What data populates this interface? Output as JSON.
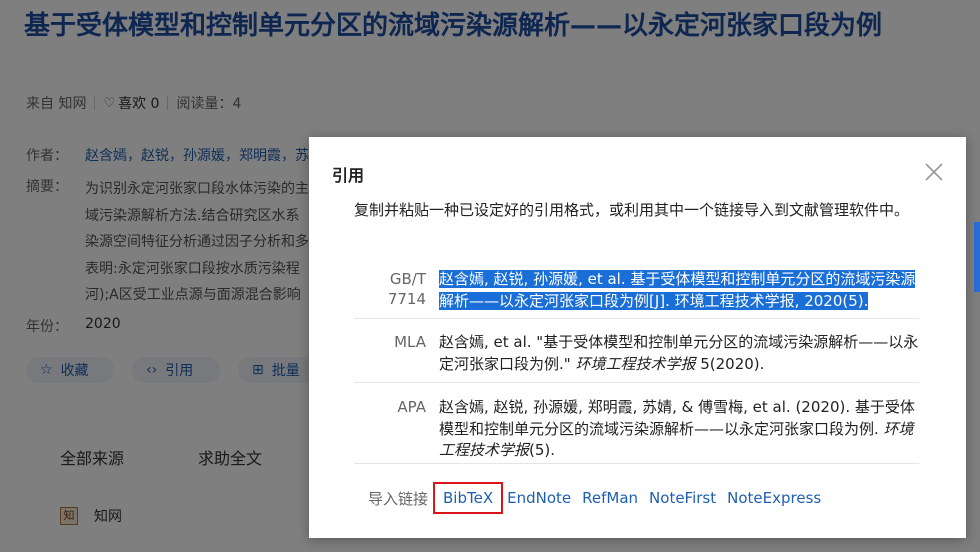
{
  "article": {
    "title": "基于受体模型和控制单元分区的流域污染源解析——以永定河张家口段为例",
    "source": "来自 知网",
    "like_label": "喜欢 0",
    "reads_label": "阅读量：4",
    "authors_label": "作者：",
    "authors": "赵含嫣，赵锐，孙源媛，郑明霞，苏",
    "abstract_label": "摘要：",
    "abstract_lines": [
      "为识别永定河张家口段水体污染的主",
      "域污染源解析方法.结合研究区水系",
      "染源空间特征分析通过因子分析和多",
      "表明:永定河张家口段按水质污染程",
      "河);A区受工业点源与面源混合影响"
    ],
    "year_label": "年份：",
    "year": "2020",
    "actions": {
      "favorite": "收藏",
      "cite": "引用",
      "batch": "批量"
    },
    "source_tabs": [
      "全部来源",
      "求助全文"
    ],
    "source_item": "知网",
    "source_logo": "知"
  },
  "modal": {
    "title": "引用",
    "instruction": "复制并粘贴一种已设定好的引用格式，或利用其中一个链接导入到文献管理软件中。",
    "citations": {
      "gbt": {
        "label": "GB/T 7714",
        "text": "赵含嫣, 赵锐, 孙源媛, et al. 基于受体模型和控制单元分区的流域污染源解析——以永定河张家口段为例[J]. 环境工程技术学报, 2020(5)."
      },
      "mla": {
        "label": "MLA",
        "text_before": "赵含嫣, et al. \"基于受体模型和控制单元分区的流域污染源解析——以永定河张家口段为例.\" ",
        "journal": "环境工程技术学报",
        "text_after": " 5(2020)."
      },
      "apa": {
        "label": "APA",
        "text_before": "赵含嫣, 赵锐, 孙源媛, 郑明霞, 苏婧, & 傅雪梅, et al. (2020). 基于受体模型和控制单元分区的流域污染源解析——以永定河张家口段为例. ",
        "journal": "环境工程技术学报",
        "text_after": "(5)."
      }
    },
    "import": {
      "label": "导入链接",
      "links": [
        "BibTeX",
        "EndNote",
        "RefMan",
        "NoteFirst",
        "NoteExpress"
      ]
    }
  },
  "colors": {
    "title": "#1f4fa0",
    "link": "#1f5fb0",
    "selection": "#1a6ed8",
    "highlight_box": "#d9141b"
  }
}
